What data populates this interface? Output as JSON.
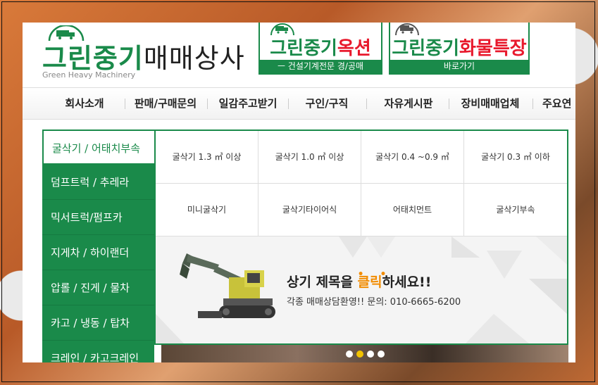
{
  "header": {
    "logo_title_green": "그린중기",
    "logo_title_black": "매매상사",
    "logo_subtitle": "Green Heavy Machinery",
    "banner_auction": {
      "title_green": "그린중기",
      "title_red": "옥션",
      "subtitle": "ㅡ 건설기계전문 경/공매"
    },
    "banner_cargo": {
      "title_green": "그린중기",
      "title_red": "화물특장",
      "subtitle": "바로가기"
    }
  },
  "nav": {
    "items": [
      "회사소개",
      "판매/구매문의",
      "일감주고받기",
      "구인/구직",
      "자유게시판",
      "장비매매업체",
      "주요연"
    ]
  },
  "left_menu": {
    "items": [
      "굴삭기 / 어태치부속",
      "덤프트럭 / 추레라",
      "믹서트럭/펌프카",
      "지게차 / 하이랜더",
      "압롤 / 진게 / 물차",
      "카고 / 냉동 / 탑차",
      "크레인 / 카고크레인"
    ],
    "active_index": 0
  },
  "submenu": {
    "row1": [
      "굴삭기 1.3 ㎥ 이상",
      "굴삭기 1.0 ㎥ 이상",
      "굴삭기 0.4 ~0.9 ㎥",
      "굴삭기 0.3 ㎥ 이하"
    ],
    "row2": [
      "미니굴삭기",
      "굴삭기타이어식",
      "어태치먼트",
      "굴삭기부속"
    ]
  },
  "promo": {
    "title_pre": "상기 제목을 ",
    "title_highlight": "클릭",
    "title_post": "하세요!!",
    "dots": "• •",
    "subtitle": "각종 매매상담환영!! 문의: 010-6665-6200"
  },
  "slider": {
    "count": 4,
    "active_index": 1
  },
  "colors": {
    "brand_green": "#1a8a4a",
    "accent_red": "#e8192c",
    "accent_orange": "#f28c00",
    "dot_active": "#f2c200"
  }
}
